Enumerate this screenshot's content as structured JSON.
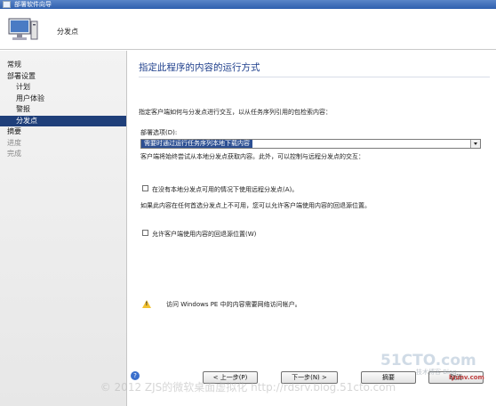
{
  "window": {
    "title": "部署软件向导"
  },
  "header": {
    "title": "分发点"
  },
  "sidebar": {
    "items": [
      {
        "label": "常规"
      },
      {
        "label": "部署设置"
      },
      {
        "label": "计划"
      },
      {
        "label": "用户体验"
      },
      {
        "label": "警报"
      },
      {
        "label": "分发点"
      },
      {
        "label": "摘要"
      },
      {
        "label": "进度"
      },
      {
        "label": "完成"
      }
    ]
  },
  "main": {
    "title": "指定此程序的内容的运行方式",
    "intro": "指定客户端如何与分发点进行交互，以从任务序列引用的包检索内容：",
    "deploy_label": "部署选项(D):",
    "deploy_value": "需要时通过运行任务序列本地下载内容",
    "deploy_note": "客户端将始终尝试从本地分发点获取内容。此外，可以控制与远程分发点的交互：",
    "checkbox1_label": "在没有本地分发点可用的情况下使用远程分发点(A)。",
    "fallback_note": "如果此内容在任何首选分发点上不可用，您可以允许客户端使用内容的回退源位置。",
    "checkbox2_label": "允许客户端使用内容的回退源位置(W)",
    "warning_text": "访问 Windows PE 中的内容需要网络访问帐户。"
  },
  "footer": {
    "help_icon": "?",
    "prev_label": "< 上一步(P)",
    "next_label": "下一步(N) >",
    "summary_label": "摘要",
    "cancel_label": "取消"
  },
  "watermark": {
    "text": "© 2012 ZJS的微软桌面虚拟化 http://rdsrv.blog.51cto.com",
    "logo": "51CTO.com",
    "logo_sub": "技术博客  Blog",
    "logo2": "lyunv.com"
  },
  "colors": {
    "selected_nav": "#1f3f7a",
    "title_blue": "#1e3f8c",
    "select_highlight": "#2c4f93"
  }
}
